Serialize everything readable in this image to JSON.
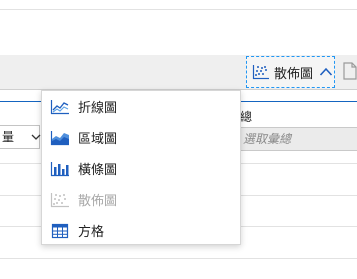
{
  "toolbar": {
    "chart_type_label": "散佈圖"
  },
  "form": {
    "left_field_value": "量",
    "summary_label": "總",
    "summary_placeholder": "選取彙總"
  },
  "menu": {
    "items": [
      {
        "label": "折線圖",
        "icon": "line-chart-icon",
        "enabled": true
      },
      {
        "label": "區域圖",
        "icon": "area-chart-icon",
        "enabled": true
      },
      {
        "label": "橫條圖",
        "icon": "bar-chart-icon",
        "enabled": true
      },
      {
        "label": "散佈圖",
        "icon": "scatter-chart-icon",
        "enabled": false
      },
      {
        "label": "方格",
        "icon": "grid-icon",
        "enabled": true
      }
    ]
  },
  "colors": {
    "accent": "#1565c0",
    "focus_border": "#2196f3",
    "disabled_text": "#a8a8a8"
  }
}
